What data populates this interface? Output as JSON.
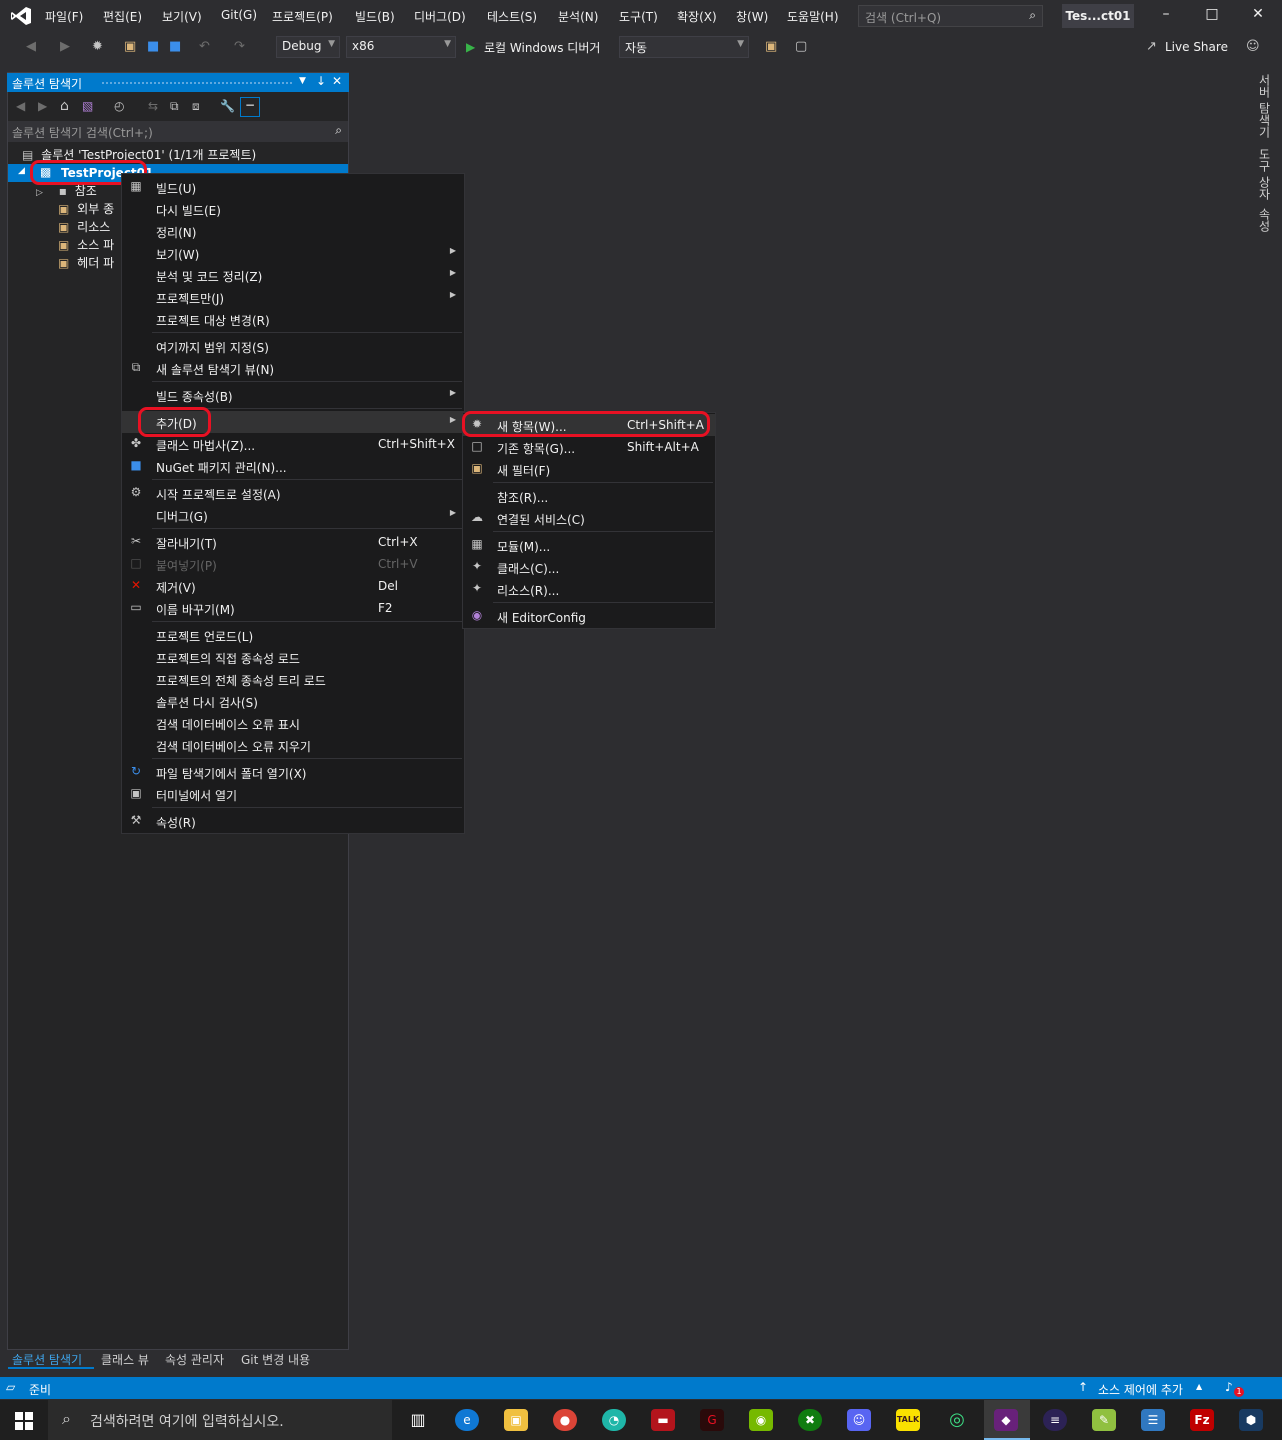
{
  "menu": {
    "items": [
      "파일(F)",
      "편집(E)",
      "보기(V)",
      "Git(G)",
      "프로젝트(P)",
      "빌드(B)",
      "디버그(D)",
      "테스트(S)",
      "분석(N)",
      "도구(T)",
      "확장(X)",
      "창(W)",
      "도움말(H)"
    ],
    "search_placeholder": "검색 (Ctrl+Q)",
    "solution_badge": "Tes...ct01"
  },
  "toolbar": {
    "config": "Debug",
    "platform": "x86",
    "run_label": "로컬 Windows 디버거",
    "run_mode": "자동",
    "live_share": "Live Share"
  },
  "solution_explorer": {
    "title": "솔루션 탐색기",
    "search_placeholder": "솔루션 탐색기 검색(Ctrl+;)",
    "solution_node": "솔루션 'TestProject01' (1/1개 프로젝트)",
    "project_node": "TestProject01",
    "children": [
      "참조",
      "외부 종",
      "리소스",
      "소스 파",
      "헤더 파"
    ]
  },
  "context_menu": [
    {
      "label": "빌드(U)",
      "icon": "build-icon"
    },
    {
      "label": "다시 빌드(E)"
    },
    {
      "label": "정리(N)"
    },
    {
      "label": "보기(W)",
      "sub": true
    },
    {
      "label": "분석 및 코드 정리(Z)",
      "sub": true
    },
    {
      "label": "프로젝트만(J)",
      "sub": true
    },
    {
      "label": "프로젝트 대상 변경(R)"
    },
    {
      "label": "여기까지 범위 지정(S)"
    },
    {
      "label": "새 솔루션 탐색기 뷰(N)",
      "icon": "new-view-icon"
    },
    {
      "label": "빌드 종속성(B)",
      "sub": true
    },
    {
      "label": "추가(D)",
      "sub": true
    },
    {
      "label": "클래스 마법사(Z)...",
      "shortcut": "Ctrl+Shift+X",
      "icon": "class-wizard-icon"
    },
    {
      "label": "NuGet 패키지 관리(N)...",
      "icon": "nuget-icon"
    },
    {
      "label": "시작 프로젝트로 설정(A)",
      "icon": "gear-icon"
    },
    {
      "label": "디버그(G)",
      "sub": true
    },
    {
      "label": "잘라내기(T)",
      "shortcut": "Ctrl+X",
      "icon": "scissors-icon"
    },
    {
      "label": "붙여넣기(P)",
      "shortcut": "Ctrl+V",
      "icon": "paste-icon",
      "disabled": true
    },
    {
      "label": "제거(V)",
      "shortcut": "Del",
      "icon": "remove-icon"
    },
    {
      "label": "이름 바꾸기(M)",
      "shortcut": "F2",
      "icon": "rename-icon"
    },
    {
      "label": "프로젝트 언로드(L)"
    },
    {
      "label": "프로젝트의 직접 종속성 로드"
    },
    {
      "label": "프로젝트의 전체 종속성 트리 로드"
    },
    {
      "label": "솔루션 다시 검사(S)"
    },
    {
      "label": "검색 데이터베이스 오류 표시"
    },
    {
      "label": "검색 데이터베이스 오류 지우기"
    },
    {
      "label": "파일 탐색기에서 폴더 열기(X)",
      "icon": "refresh-icon"
    },
    {
      "label": "터미널에서 열기",
      "icon": "terminal-icon"
    },
    {
      "label": "속성(R)",
      "icon": "wrench-icon"
    }
  ],
  "submenu": [
    {
      "label": "새 항목(W)...",
      "shortcut": "Ctrl+Shift+A",
      "icon": "new-item-icon"
    },
    {
      "label": "기존 항목(G)...",
      "shortcut": "Shift+Alt+A",
      "icon": "existing-item-icon"
    },
    {
      "label": "새 필터(F)",
      "icon": "folder-icon"
    },
    {
      "label": "참조(R)..."
    },
    {
      "label": "연결된 서비스(C)",
      "icon": "connected-service-icon"
    },
    {
      "label": "모듈(M)...",
      "icon": "module-icon"
    },
    {
      "label": "클래스(C)...",
      "icon": "class-icon"
    },
    {
      "label": "리소스(R)...",
      "icon": "resource-icon"
    },
    {
      "label": "새 EditorConfig",
      "icon": "lightbulb-icon"
    }
  ],
  "right_tabs": [
    "서버 탐색기",
    "도구 상자",
    "속성"
  ],
  "bottom_tabs": [
    "솔루션 탐색기",
    "클래스 뷰",
    "속성 관리자",
    "Git 변경 내용"
  ],
  "status": {
    "ready": "준비",
    "source_control": "소스 제어에 추가",
    "notification_count": "1"
  },
  "taskbar": {
    "search_placeholder": "검색하려면 여기에 입력하십시오.",
    "apps": [
      "task-view",
      "edge",
      "file-explorer",
      "chrome",
      "app-teal",
      "app-red",
      "app-g",
      "nvidia",
      "xbox",
      "discord",
      "kakaotalk",
      "app-green",
      "visual-studio",
      "eclipse",
      "notepad-plus",
      "network-app",
      "filezilla",
      "virtualbox"
    ]
  },
  "colors": {
    "accent": "#007acc",
    "highlight_ring": "#e81123",
    "menu_bg": "#1b1b1c",
    "ide_bg": "#2d2d30"
  }
}
